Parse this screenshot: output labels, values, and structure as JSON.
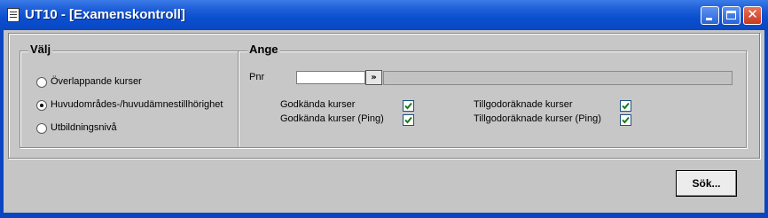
{
  "window": {
    "title": "UT10 - [Examenskontroll]",
    "icons": [
      "document-icon",
      "minimize-icon",
      "maximize-icon",
      "close-icon"
    ]
  },
  "valj": {
    "legend": "Välj",
    "options": [
      {
        "label": "Överlappande kurser",
        "selected": false
      },
      {
        "label": "Huvudområdes-/huvudämnestillhörighet",
        "selected": true
      },
      {
        "label": "Utbildningsnivå",
        "selected": false
      }
    ]
  },
  "ange": {
    "legend": "Ange",
    "pnr_label": "Pnr",
    "pnr_value": "",
    "pnr_button": "»",
    "checks": [
      {
        "label": "Godkända kurser",
        "checked": true
      },
      {
        "label": "Godkända kurser (Ping)",
        "checked": true
      },
      {
        "label": "Tillgodoräknade kurser",
        "checked": true
      },
      {
        "label": "Tillgodoräknade kurser (Ping)",
        "checked": true
      }
    ]
  },
  "actions": {
    "search_label": "Sök..."
  }
}
